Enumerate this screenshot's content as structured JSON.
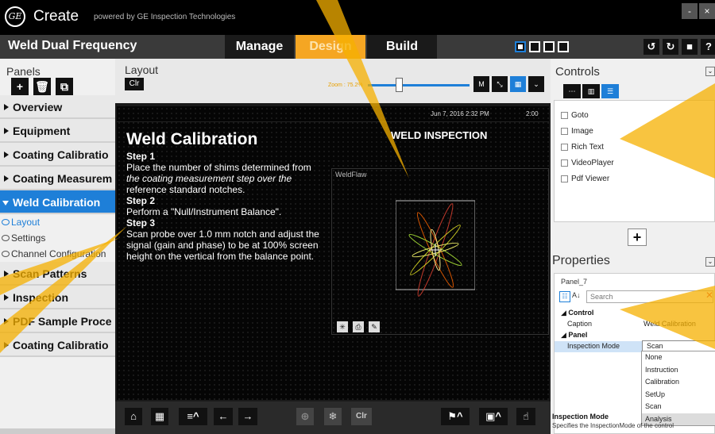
{
  "colors": {
    "accent": "#1e7fd8",
    "design_tab": "#f5a623",
    "beam": "#f5b000"
  },
  "titlebar": {
    "logo": "GE",
    "app_name": "Create",
    "powered": "powered by  GE Inspection Technologies",
    "minimize": "-",
    "close": "×"
  },
  "toolbar": {
    "project_title": "Weld Dual Frequency",
    "tabs": {
      "manage": "Manage",
      "design": "Design",
      "build": "Build"
    },
    "undo": "↺",
    "redo": "↻",
    "save": "■",
    "help": "?"
  },
  "left": {
    "panels_label": "Panels",
    "tools": {
      "add": "+",
      "delete": "🗑",
      "copy": "⧉"
    },
    "items": [
      {
        "label": "Overview"
      },
      {
        "label": "Equipment"
      },
      {
        "label": "Coating Calibratio"
      },
      {
        "label": "Coating Measurem"
      },
      {
        "label": "Weld Calibration"
      }
    ],
    "subitems": [
      {
        "label": "Layout"
      },
      {
        "label": "Settings"
      },
      {
        "label": "Channel Configuration"
      }
    ],
    "items2": [
      {
        "label": "Scan Patterns"
      },
      {
        "label": "Inspection"
      },
      {
        "label": "PDF Sample Proce"
      },
      {
        "label": "Coating Calibratio"
      }
    ]
  },
  "center": {
    "layout_label": "Layout",
    "clr": "Clr",
    "zoom": "Zoom : 75.2%",
    "zoom_fraction": 0.31,
    "zoom_tools": {
      "m": "M",
      "fit": "⤡",
      "grid": "▦",
      "more": "⌄"
    }
  },
  "stage": {
    "date": "Jun 7, 2016 2:32 PM",
    "time": "2:00",
    "title": "Weld Calibration",
    "step1_h": "Step 1",
    "step1_a": "Place the number of shims determined from",
    "step1_b": "the coating measurement step over the",
    "step1_c": "reference standard notches.",
    "step2_h": "Step 2",
    "step2_a": "Perform a \"Null/Instrument Balance\".",
    "step3_h": "Step 3",
    "step3_a": "Scan probe over 1.0 mm notch and adjust the",
    "step3_b": "signal (gain and phase) to be at 100% screen",
    "step3_c": "height on the vertical from the balance point.",
    "insp_title": "WELD INSPECTION",
    "weldflaw": "WeldFlaw"
  },
  "bottom": {
    "home": "⌂",
    "grid": "▦",
    "menu": "≡^",
    "left": "←",
    "right": "→",
    "target": "⊕",
    "snow": "❄",
    "clr": "Clr",
    "probe": "⚑^",
    "camera": "▣^",
    "hand": "☝"
  },
  "controls": {
    "label": "Controls",
    "collapse": "⌄",
    "items": [
      {
        "label": "Goto"
      },
      {
        "label": "Image"
      },
      {
        "label": "Rich Text"
      },
      {
        "label": "VideoPlayer"
      },
      {
        "label": "Pdf Viewer"
      }
    ],
    "add": "+"
  },
  "properties": {
    "label": "Properties",
    "collapse": "⌄",
    "panel_name": "Panel_7",
    "sort": "☷",
    "az": "A↓",
    "search_placeholder": "Search",
    "clear": "✕",
    "cat_control": "Control",
    "caption_key": "Caption",
    "caption_val": "Weld Calibration",
    "cat_panel": "Panel",
    "mode_key": "Inspection Mode",
    "mode_val": "Scan",
    "options": [
      {
        "label": "None"
      },
      {
        "label": "Instruction"
      },
      {
        "label": "Calibration"
      },
      {
        "label": "SetUp"
      },
      {
        "label": "Scan"
      },
      {
        "label": "Analysis"
      }
    ],
    "desc_title": "Inspection Mode",
    "desc_text": "Specifies the InspectionMode of the control"
  }
}
